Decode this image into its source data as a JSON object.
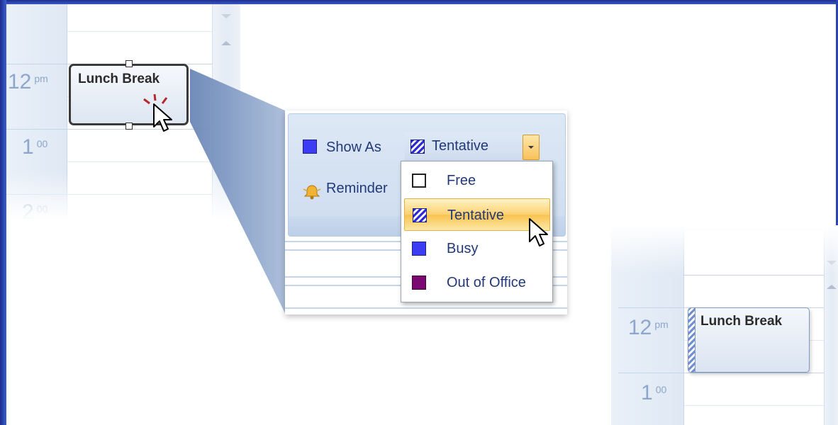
{
  "left_calendar": {
    "hours": [
      {
        "hour": "12",
        "suffix": "pm"
      },
      {
        "hour": "1",
        "suffix": "00"
      },
      {
        "hour": "2",
        "suffix": "00"
      }
    ],
    "appointment_title": "Lunch Break"
  },
  "ribbon": {
    "show_as_label": "Show As",
    "reminder_label": "Reminder",
    "show_as_value": "Tentative"
  },
  "dropdown": {
    "options": [
      {
        "label": "Free",
        "icon": "free-swatch",
        "color": "#ffffff"
      },
      {
        "label": "Tentative",
        "icon": "tentative-swatch",
        "color": "#2b2bd6",
        "selected": true
      },
      {
        "label": "Busy",
        "icon": "busy-swatch",
        "color": "#3c3cf4"
      },
      {
        "label": "Out of Office",
        "icon": "out-of-office-swatch",
        "color": "#7a0a72"
      }
    ]
  },
  "right_calendar": {
    "hours": [
      {
        "hour": "12",
        "suffix": "pm"
      },
      {
        "hour": "1",
        "suffix": "00"
      }
    ],
    "appointment_title": "Lunch Break"
  },
  "colors": {
    "frame": "#2a45b0",
    "text": "#22397a",
    "highlight": "#fbd170"
  }
}
